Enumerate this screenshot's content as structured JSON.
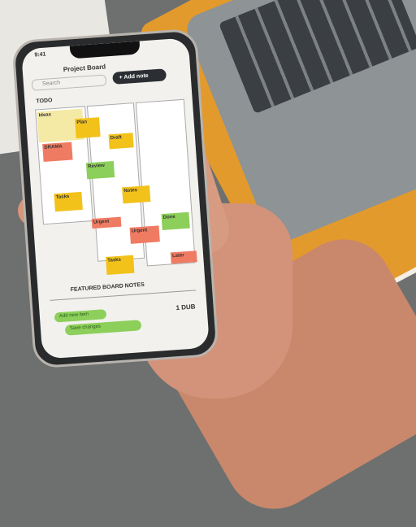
{
  "phone": {
    "status_time": "9:41",
    "app_title": "Project Board",
    "search_placeholder": "Search",
    "header_button": "+ Add note",
    "section_label": "TODO",
    "notes": [
      {
        "label": "Ideas",
        "color": "#f5e9a6"
      },
      {
        "label": "Plan",
        "color": "#f2c21b"
      },
      {
        "label": "DRAMA",
        "color": "#f07b63"
      },
      {
        "label": "Draft",
        "color": "#f2c21b"
      },
      {
        "label": "Review",
        "color": "#8ccf5a"
      },
      {
        "label": "Tasks",
        "color": "#f2c21b"
      },
      {
        "label": "Notes",
        "color": "#f2c21b"
      },
      {
        "label": "Urgent",
        "color": "#f07b63"
      },
      {
        "label": "Done",
        "color": "#8ccf5a"
      },
      {
        "label": "Urgent",
        "color": "#f07b63"
      },
      {
        "label": "Tasks",
        "color": "#f2c21b"
      },
      {
        "label": "Later",
        "color": "#f07b63"
      }
    ],
    "footer_title": "FEATURED BOARD NOTES",
    "footer_button_1": "Add new item",
    "footer_button_2": "Save changes",
    "page_count": "1 DUB"
  }
}
